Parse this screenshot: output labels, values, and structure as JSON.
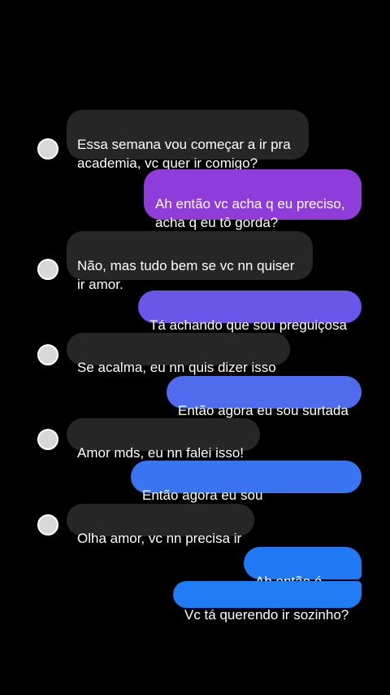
{
  "colors": {
    "background": "#000000",
    "received_bubble": "#262626",
    "sent_gradient": [
      "#8e3ddb",
      "#4e6df0",
      "#1f7cf5"
    ],
    "avatar": "#d8d8d8"
  },
  "messages": [
    {
      "from": "them",
      "text": "Essa semana vou começar a ir pra\nacademia, vc quer ir comigo?"
    },
    {
      "from": "me",
      "text": "Ah então vc acha q eu preciso,\nacha q eu tô gorda?"
    },
    {
      "from": "them",
      "text": "Não, mas tudo bem se vc nn quiser\nir amor."
    },
    {
      "from": "me",
      "text": "Tá achando que sou preguiçosa"
    },
    {
      "from": "them",
      "text": "Se acalma, eu nn quis dizer isso"
    },
    {
      "from": "me",
      "text": "Então agora eu sou surtada"
    },
    {
      "from": "them",
      "text": "Amor mds, eu nn falei isso!"
    },
    {
      "from": "me",
      "text": "Então agora eu sou mentirosa???"
    },
    {
      "from": "them",
      "text": "Olha amor, vc nn precisa ir"
    },
    {
      "from": "me",
      "text": "Ah então é isso"
    },
    {
      "from": "me",
      "text": "Vc tá querendo ir sozinho?"
    }
  ]
}
